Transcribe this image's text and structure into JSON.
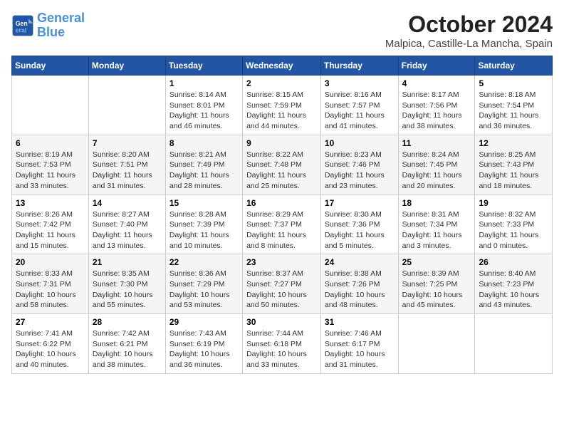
{
  "header": {
    "logo_line1": "General",
    "logo_line2": "Blue",
    "title": "October 2024",
    "subtitle": "Malpica, Castille-La Mancha, Spain"
  },
  "days_of_week": [
    "Sunday",
    "Monday",
    "Tuesday",
    "Wednesday",
    "Thursday",
    "Friday",
    "Saturday"
  ],
  "weeks": [
    [
      {
        "day": "",
        "detail": ""
      },
      {
        "day": "",
        "detail": ""
      },
      {
        "day": "1",
        "detail": "Sunrise: 8:14 AM\nSunset: 8:01 PM\nDaylight: 11 hours and 46 minutes."
      },
      {
        "day": "2",
        "detail": "Sunrise: 8:15 AM\nSunset: 7:59 PM\nDaylight: 11 hours and 44 minutes."
      },
      {
        "day": "3",
        "detail": "Sunrise: 8:16 AM\nSunset: 7:57 PM\nDaylight: 11 hours and 41 minutes."
      },
      {
        "day": "4",
        "detail": "Sunrise: 8:17 AM\nSunset: 7:56 PM\nDaylight: 11 hours and 38 minutes."
      },
      {
        "day": "5",
        "detail": "Sunrise: 8:18 AM\nSunset: 7:54 PM\nDaylight: 11 hours and 36 minutes."
      }
    ],
    [
      {
        "day": "6",
        "detail": "Sunrise: 8:19 AM\nSunset: 7:53 PM\nDaylight: 11 hours and 33 minutes."
      },
      {
        "day": "7",
        "detail": "Sunrise: 8:20 AM\nSunset: 7:51 PM\nDaylight: 11 hours and 31 minutes."
      },
      {
        "day": "8",
        "detail": "Sunrise: 8:21 AM\nSunset: 7:49 PM\nDaylight: 11 hours and 28 minutes."
      },
      {
        "day": "9",
        "detail": "Sunrise: 8:22 AM\nSunset: 7:48 PM\nDaylight: 11 hours and 25 minutes."
      },
      {
        "day": "10",
        "detail": "Sunrise: 8:23 AM\nSunset: 7:46 PM\nDaylight: 11 hours and 23 minutes."
      },
      {
        "day": "11",
        "detail": "Sunrise: 8:24 AM\nSunset: 7:45 PM\nDaylight: 11 hours and 20 minutes."
      },
      {
        "day": "12",
        "detail": "Sunrise: 8:25 AM\nSunset: 7:43 PM\nDaylight: 11 hours and 18 minutes."
      }
    ],
    [
      {
        "day": "13",
        "detail": "Sunrise: 8:26 AM\nSunset: 7:42 PM\nDaylight: 11 hours and 15 minutes."
      },
      {
        "day": "14",
        "detail": "Sunrise: 8:27 AM\nSunset: 7:40 PM\nDaylight: 11 hours and 13 minutes."
      },
      {
        "day": "15",
        "detail": "Sunrise: 8:28 AM\nSunset: 7:39 PM\nDaylight: 11 hours and 10 minutes."
      },
      {
        "day": "16",
        "detail": "Sunrise: 8:29 AM\nSunset: 7:37 PM\nDaylight: 11 hours and 8 minutes."
      },
      {
        "day": "17",
        "detail": "Sunrise: 8:30 AM\nSunset: 7:36 PM\nDaylight: 11 hours and 5 minutes."
      },
      {
        "day": "18",
        "detail": "Sunrise: 8:31 AM\nSunset: 7:34 PM\nDaylight: 11 hours and 3 minutes."
      },
      {
        "day": "19",
        "detail": "Sunrise: 8:32 AM\nSunset: 7:33 PM\nDaylight: 11 hours and 0 minutes."
      }
    ],
    [
      {
        "day": "20",
        "detail": "Sunrise: 8:33 AM\nSunset: 7:31 PM\nDaylight: 10 hours and 58 minutes."
      },
      {
        "day": "21",
        "detail": "Sunrise: 8:35 AM\nSunset: 7:30 PM\nDaylight: 10 hours and 55 minutes."
      },
      {
        "day": "22",
        "detail": "Sunrise: 8:36 AM\nSunset: 7:29 PM\nDaylight: 10 hours and 53 minutes."
      },
      {
        "day": "23",
        "detail": "Sunrise: 8:37 AM\nSunset: 7:27 PM\nDaylight: 10 hours and 50 minutes."
      },
      {
        "day": "24",
        "detail": "Sunrise: 8:38 AM\nSunset: 7:26 PM\nDaylight: 10 hours and 48 minutes."
      },
      {
        "day": "25",
        "detail": "Sunrise: 8:39 AM\nSunset: 7:25 PM\nDaylight: 10 hours and 45 minutes."
      },
      {
        "day": "26",
        "detail": "Sunrise: 8:40 AM\nSunset: 7:23 PM\nDaylight: 10 hours and 43 minutes."
      }
    ],
    [
      {
        "day": "27",
        "detail": "Sunrise: 7:41 AM\nSunset: 6:22 PM\nDaylight: 10 hours and 40 minutes."
      },
      {
        "day": "28",
        "detail": "Sunrise: 7:42 AM\nSunset: 6:21 PM\nDaylight: 10 hours and 38 minutes."
      },
      {
        "day": "29",
        "detail": "Sunrise: 7:43 AM\nSunset: 6:19 PM\nDaylight: 10 hours and 36 minutes."
      },
      {
        "day": "30",
        "detail": "Sunrise: 7:44 AM\nSunset: 6:18 PM\nDaylight: 10 hours and 33 minutes."
      },
      {
        "day": "31",
        "detail": "Sunrise: 7:46 AM\nSunset: 6:17 PM\nDaylight: 10 hours and 31 minutes."
      },
      {
        "day": "",
        "detail": ""
      },
      {
        "day": "",
        "detail": ""
      }
    ]
  ]
}
